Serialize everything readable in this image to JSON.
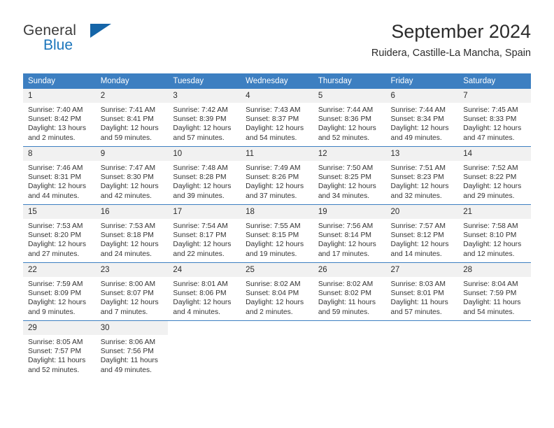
{
  "brand": {
    "name_part1": "General",
    "name_part2": "Blue",
    "triangle_icon": "triangle-icon",
    "accent_color": "#1b75bb"
  },
  "header": {
    "title": "September 2024",
    "location": "Ruidera, Castille-La Mancha, Spain"
  },
  "theme": {
    "header_blue": "#3d7fc1",
    "daynum_band": "#f1f1f1",
    "text": "#333333"
  },
  "weekday_headers": [
    "Sunday",
    "Monday",
    "Tuesday",
    "Wednesday",
    "Thursday",
    "Friday",
    "Saturday"
  ],
  "labels": {
    "sunrise_prefix": "Sunrise:",
    "sunset_prefix": "Sunset:",
    "daylight_prefix": "Daylight:"
  },
  "weeks": [
    [
      {
        "day": "1",
        "sunrise": "Sunrise: 7:40 AM",
        "sunset": "Sunset: 8:42 PM",
        "daylight_line1": "Daylight: 13 hours",
        "daylight_line2": "and 2 minutes."
      },
      {
        "day": "2",
        "sunrise": "Sunrise: 7:41 AM",
        "sunset": "Sunset: 8:41 PM",
        "daylight_line1": "Daylight: 12 hours",
        "daylight_line2": "and 59 minutes."
      },
      {
        "day": "3",
        "sunrise": "Sunrise: 7:42 AM",
        "sunset": "Sunset: 8:39 PM",
        "daylight_line1": "Daylight: 12 hours",
        "daylight_line2": "and 57 minutes."
      },
      {
        "day": "4",
        "sunrise": "Sunrise: 7:43 AM",
        "sunset": "Sunset: 8:37 PM",
        "daylight_line1": "Daylight: 12 hours",
        "daylight_line2": "and 54 minutes."
      },
      {
        "day": "5",
        "sunrise": "Sunrise: 7:44 AM",
        "sunset": "Sunset: 8:36 PM",
        "daylight_line1": "Daylight: 12 hours",
        "daylight_line2": "and 52 minutes."
      },
      {
        "day": "6",
        "sunrise": "Sunrise: 7:44 AM",
        "sunset": "Sunset: 8:34 PM",
        "daylight_line1": "Daylight: 12 hours",
        "daylight_line2": "and 49 minutes."
      },
      {
        "day": "7",
        "sunrise": "Sunrise: 7:45 AM",
        "sunset": "Sunset: 8:33 PM",
        "daylight_line1": "Daylight: 12 hours",
        "daylight_line2": "and 47 minutes."
      }
    ],
    [
      {
        "day": "8",
        "sunrise": "Sunrise: 7:46 AM",
        "sunset": "Sunset: 8:31 PM",
        "daylight_line1": "Daylight: 12 hours",
        "daylight_line2": "and 44 minutes."
      },
      {
        "day": "9",
        "sunrise": "Sunrise: 7:47 AM",
        "sunset": "Sunset: 8:30 PM",
        "daylight_line1": "Daylight: 12 hours",
        "daylight_line2": "and 42 minutes."
      },
      {
        "day": "10",
        "sunrise": "Sunrise: 7:48 AM",
        "sunset": "Sunset: 8:28 PM",
        "daylight_line1": "Daylight: 12 hours",
        "daylight_line2": "and 39 minutes."
      },
      {
        "day": "11",
        "sunrise": "Sunrise: 7:49 AM",
        "sunset": "Sunset: 8:26 PM",
        "daylight_line1": "Daylight: 12 hours",
        "daylight_line2": "and 37 minutes."
      },
      {
        "day": "12",
        "sunrise": "Sunrise: 7:50 AM",
        "sunset": "Sunset: 8:25 PM",
        "daylight_line1": "Daylight: 12 hours",
        "daylight_line2": "and 34 minutes."
      },
      {
        "day": "13",
        "sunrise": "Sunrise: 7:51 AM",
        "sunset": "Sunset: 8:23 PM",
        "daylight_line1": "Daylight: 12 hours",
        "daylight_line2": "and 32 minutes."
      },
      {
        "day": "14",
        "sunrise": "Sunrise: 7:52 AM",
        "sunset": "Sunset: 8:22 PM",
        "daylight_line1": "Daylight: 12 hours",
        "daylight_line2": "and 29 minutes."
      }
    ],
    [
      {
        "day": "15",
        "sunrise": "Sunrise: 7:53 AM",
        "sunset": "Sunset: 8:20 PM",
        "daylight_line1": "Daylight: 12 hours",
        "daylight_line2": "and 27 minutes."
      },
      {
        "day": "16",
        "sunrise": "Sunrise: 7:53 AM",
        "sunset": "Sunset: 8:18 PM",
        "daylight_line1": "Daylight: 12 hours",
        "daylight_line2": "and 24 minutes."
      },
      {
        "day": "17",
        "sunrise": "Sunrise: 7:54 AM",
        "sunset": "Sunset: 8:17 PM",
        "daylight_line1": "Daylight: 12 hours",
        "daylight_line2": "and 22 minutes."
      },
      {
        "day": "18",
        "sunrise": "Sunrise: 7:55 AM",
        "sunset": "Sunset: 8:15 PM",
        "daylight_line1": "Daylight: 12 hours",
        "daylight_line2": "and 19 minutes."
      },
      {
        "day": "19",
        "sunrise": "Sunrise: 7:56 AM",
        "sunset": "Sunset: 8:14 PM",
        "daylight_line1": "Daylight: 12 hours",
        "daylight_line2": "and 17 minutes."
      },
      {
        "day": "20",
        "sunrise": "Sunrise: 7:57 AM",
        "sunset": "Sunset: 8:12 PM",
        "daylight_line1": "Daylight: 12 hours",
        "daylight_line2": "and 14 minutes."
      },
      {
        "day": "21",
        "sunrise": "Sunrise: 7:58 AM",
        "sunset": "Sunset: 8:10 PM",
        "daylight_line1": "Daylight: 12 hours",
        "daylight_line2": "and 12 minutes."
      }
    ],
    [
      {
        "day": "22",
        "sunrise": "Sunrise: 7:59 AM",
        "sunset": "Sunset: 8:09 PM",
        "daylight_line1": "Daylight: 12 hours",
        "daylight_line2": "and 9 minutes."
      },
      {
        "day": "23",
        "sunrise": "Sunrise: 8:00 AM",
        "sunset": "Sunset: 8:07 PM",
        "daylight_line1": "Daylight: 12 hours",
        "daylight_line2": "and 7 minutes."
      },
      {
        "day": "24",
        "sunrise": "Sunrise: 8:01 AM",
        "sunset": "Sunset: 8:06 PM",
        "daylight_line1": "Daylight: 12 hours",
        "daylight_line2": "and 4 minutes."
      },
      {
        "day": "25",
        "sunrise": "Sunrise: 8:02 AM",
        "sunset": "Sunset: 8:04 PM",
        "daylight_line1": "Daylight: 12 hours",
        "daylight_line2": "and 2 minutes."
      },
      {
        "day": "26",
        "sunrise": "Sunrise: 8:02 AM",
        "sunset": "Sunset: 8:02 PM",
        "daylight_line1": "Daylight: 11 hours",
        "daylight_line2": "and 59 minutes."
      },
      {
        "day": "27",
        "sunrise": "Sunrise: 8:03 AM",
        "sunset": "Sunset: 8:01 PM",
        "daylight_line1": "Daylight: 11 hours",
        "daylight_line2": "and 57 minutes."
      },
      {
        "day": "28",
        "sunrise": "Sunrise: 8:04 AM",
        "sunset": "Sunset: 7:59 PM",
        "daylight_line1": "Daylight: 11 hours",
        "daylight_line2": "and 54 minutes."
      }
    ],
    [
      {
        "day": "29",
        "sunrise": "Sunrise: 8:05 AM",
        "sunset": "Sunset: 7:57 PM",
        "daylight_line1": "Daylight: 11 hours",
        "daylight_line2": "and 52 minutes."
      },
      {
        "day": "30",
        "sunrise": "Sunrise: 8:06 AM",
        "sunset": "Sunset: 7:56 PM",
        "daylight_line1": "Daylight: 11 hours",
        "daylight_line2": "and 49 minutes."
      },
      {
        "day": "",
        "sunrise": "",
        "sunset": "",
        "daylight_line1": "",
        "daylight_line2": ""
      },
      {
        "day": "",
        "sunrise": "",
        "sunset": "",
        "daylight_line1": "",
        "daylight_line2": ""
      },
      {
        "day": "",
        "sunrise": "",
        "sunset": "",
        "daylight_line1": "",
        "daylight_line2": ""
      },
      {
        "day": "",
        "sunrise": "",
        "sunset": "",
        "daylight_line1": "",
        "daylight_line2": ""
      },
      {
        "day": "",
        "sunrise": "",
        "sunset": "",
        "daylight_line1": "",
        "daylight_line2": ""
      }
    ]
  ]
}
